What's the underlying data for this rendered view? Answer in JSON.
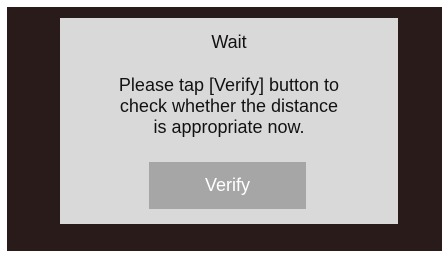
{
  "dialog": {
    "title": "Wait",
    "message_lines": [
      "Please tap [Verify] button to",
      "check whether the distance",
      "is appropriate now."
    ],
    "verify_label": "Verify"
  },
  "colors": {
    "screen_background": "#2a1b1b",
    "dialog_background": "#d9d9d9",
    "button_background": "#a6a6a6",
    "button_text": "#ffffff",
    "text": "#111111"
  }
}
